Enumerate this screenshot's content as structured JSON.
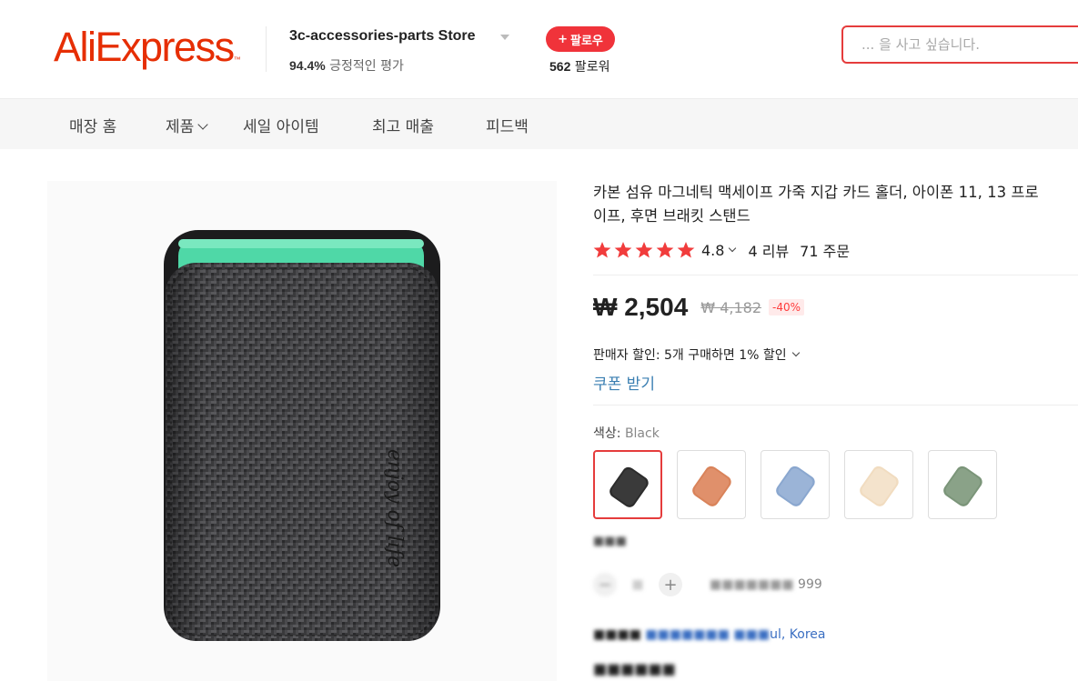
{
  "header": {
    "logo_text": "AliExpress",
    "logo_tm": "™",
    "store_name": "3c-accessories-parts Store",
    "positive_rating_pct": "94.4%",
    "positive_rating_label": " 긍정적인 평가",
    "follow_label": "팔로우",
    "follow_plus": "+",
    "followers_count": "562",
    "followers_label": " 팔로워",
    "search_placeholder": "... 을 사고 싶습니다."
  },
  "nav": {
    "items": [
      {
        "label": "매장 홈"
      },
      {
        "label": "제품"
      },
      {
        "label": "세일 아이템"
      },
      {
        "label": "최고 매출"
      },
      {
        "label": "피드백"
      }
    ]
  },
  "product": {
    "title_line1": "카본 섬유 마그네틱 맥세이프 가죽 지갑 카드 홀더, 아이폰 11, 13 프로",
    "title_line2": "이프, 후면 브래킷 스탠드",
    "image_text": "enjoy of life",
    "rating": "4.8",
    "rating_stars": 5,
    "reviews": "4 리뷰",
    "orders": "71 주문",
    "price": "₩ 2,504",
    "old_price": "₩ 4,182",
    "discount": "-40%",
    "seller_discount": "판매자 할인: 5개 구매하면 1% 할인",
    "coupon": "쿠폰 받기",
    "color_label": "색상: ",
    "color_value": "Black",
    "swatches": [
      {
        "name": "black",
        "color": "#2c2c2c"
      },
      {
        "name": "orange",
        "color": "#d9835a"
      },
      {
        "name": "blue",
        "color": "#8aa7cf"
      },
      {
        "name": "cream",
        "color": "#f1dcc0"
      },
      {
        "name": "green",
        "color": "#7b9579"
      }
    ],
    "quantity_available": "999",
    "ship_to_suffix": "ul, Korea"
  },
  "colors": {
    "brand": "#e62e04",
    "accent": "#e53c3c",
    "star": "#f13c3c",
    "link": "#3b7fb2"
  }
}
